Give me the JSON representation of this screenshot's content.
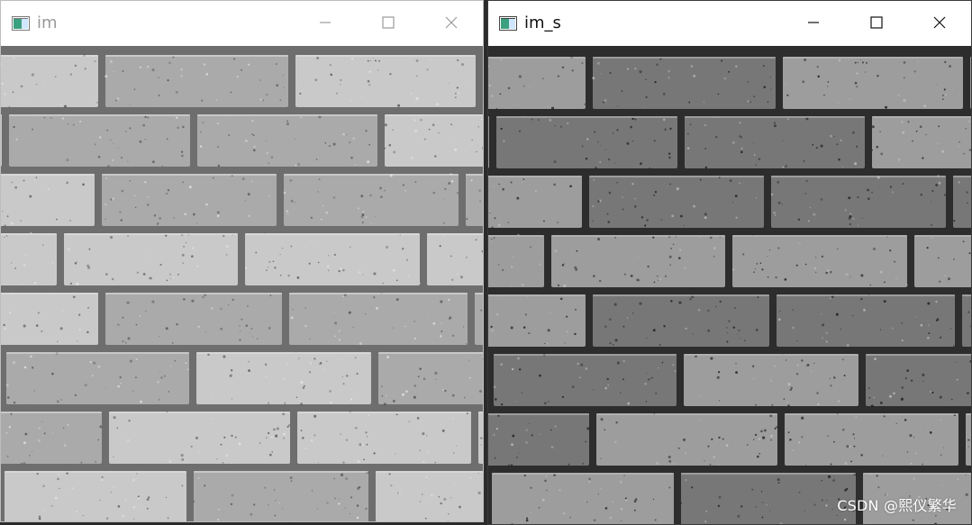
{
  "windows": [
    {
      "id": "left",
      "title": "im",
      "controls": [
        "minimize-icon",
        "maximize-icon",
        "close-icon"
      ],
      "image": {
        "kind": "brick-wall-grayscale",
        "tone": "light"
      }
    },
    {
      "id": "right",
      "title": "im_s",
      "controls": [
        "minimize-icon",
        "maximize-icon",
        "close-icon"
      ],
      "image": {
        "kind": "brick-wall-grayscale",
        "tone": "dark-sharpened"
      }
    }
  ],
  "watermark": "CSDN @熙仪繁华",
  "colors": {
    "title_inactive": "#999999",
    "title_active": "#111111",
    "titlebar_bg": "#ffffff",
    "backdrop": "#2b2b2b",
    "left_brick_light": "#c9c9c9",
    "left_brick_dark": "#aaaaaa",
    "left_mortar": "#6e6e6e",
    "right_brick_light": "#9d9d9d",
    "right_brick_dark": "#777777",
    "right_mortar": "#2d2d2d"
  }
}
